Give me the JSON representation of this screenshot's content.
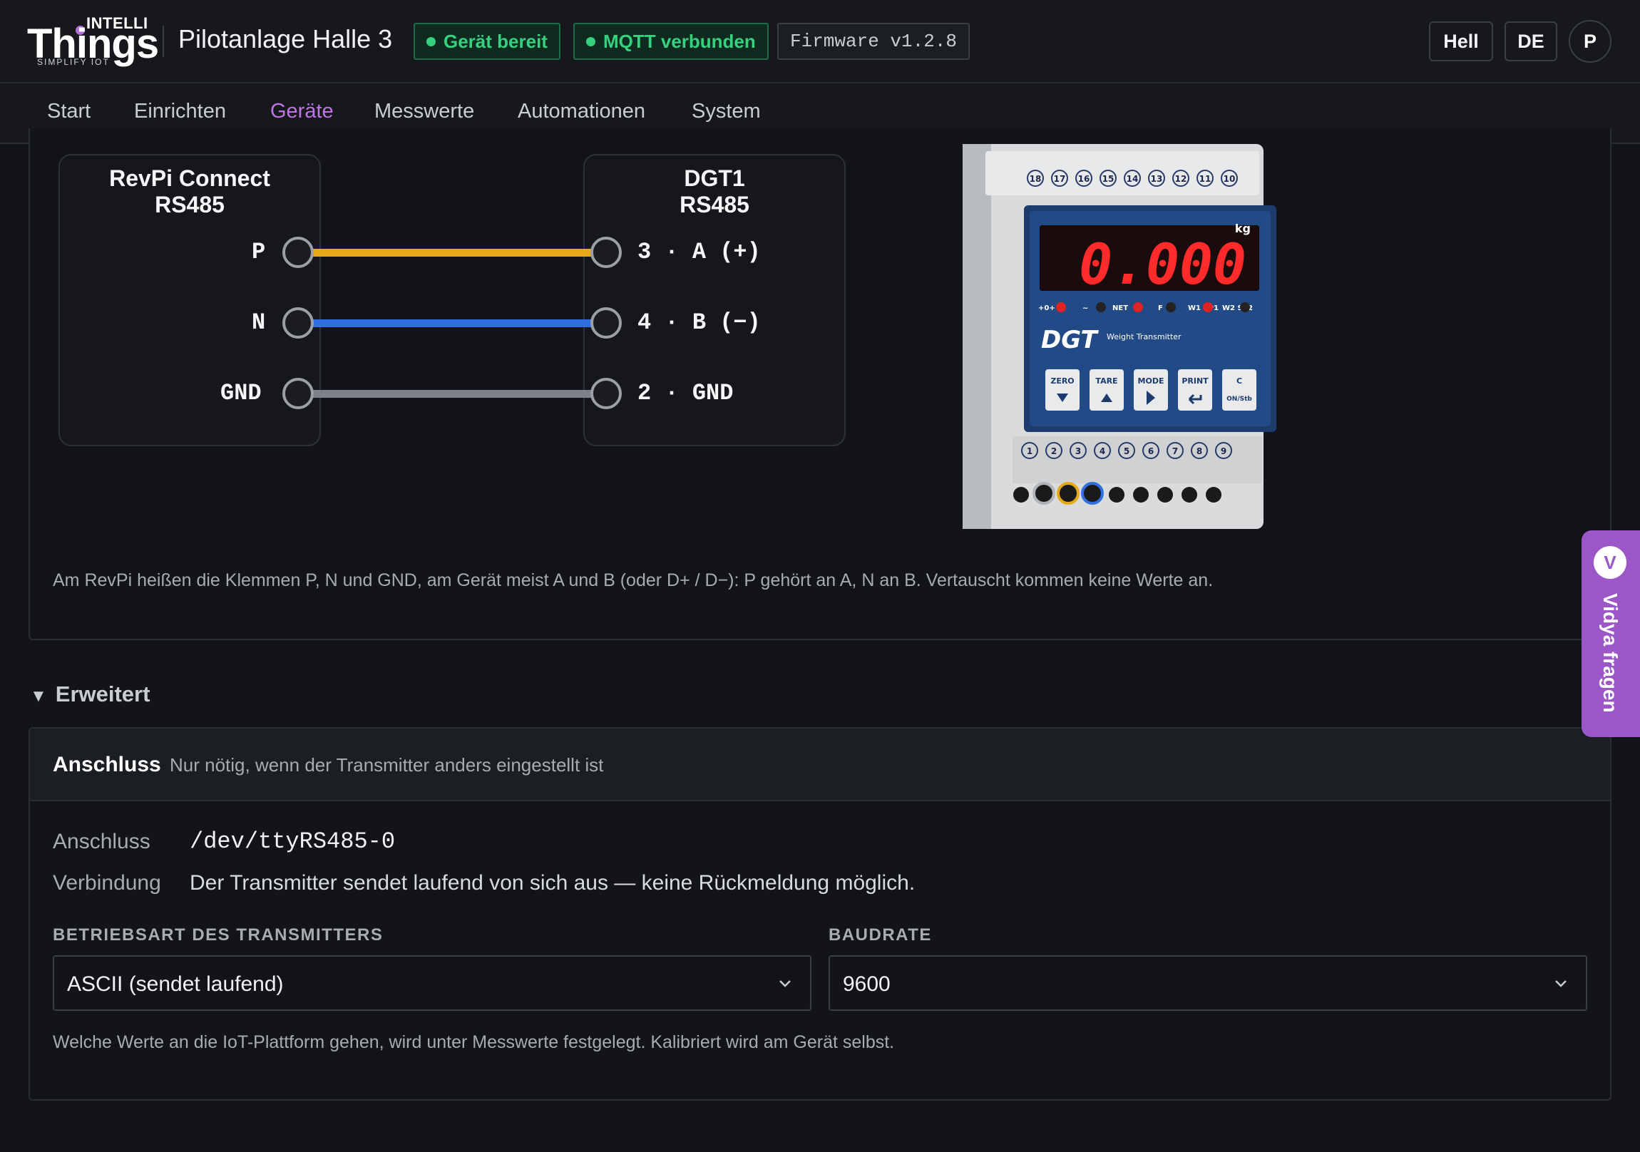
{
  "header": {
    "logo_intelli": "INTELLI",
    "logo_things": "Things",
    "logo_tagline": "SIMPLIFY IOT",
    "plant_title": "Pilotanlage Halle 3",
    "status_device": "Gerät bereit",
    "status_mqtt": "MQTT verbunden",
    "firmware": "Firmware v1.2.8",
    "theme_button": "Hell",
    "language_button": "DE",
    "avatar": "P"
  },
  "tabs": {
    "start": "Start",
    "setup": "Einrichten",
    "devices": "Geräte",
    "measurements": "Messwerte",
    "automations": "Automationen",
    "system": "System"
  },
  "wiring": {
    "left_box_title": "RevPi Connect\nRS485",
    "right_box_title": "DGT1\nRS485",
    "rows": [
      {
        "left": "P",
        "right": "3 · A (+)",
        "color": "#e6a817"
      },
      {
        "left": "N",
        "right": "4 · B (−)",
        "color": "#2f6fe0"
      },
      {
        "left": "GND",
        "right": "2 · GND",
        "color": "#7d8189"
      }
    ],
    "note": "Am RevPi heißen die Klemmen P, N und GND, am Gerät meist A und B (oder D+ / D−): P gehört an A, N an B. Vertauscht kommen keine Werte an."
  },
  "device_image": {
    "display_value": "0.000",
    "unit": "kg",
    "brand": "DGT",
    "subtitle": "Weight Transmitter",
    "keys": [
      "ZERO",
      "TARE",
      "MODE",
      "PRINT",
      "C"
    ],
    "key_sub_c": "ON/Stb",
    "top_terminals": [
      "18",
      "17",
      "16",
      "15",
      "14",
      "13",
      "12",
      "11",
      "10"
    ],
    "bottom_terminals": [
      "1",
      "2",
      "3",
      "4",
      "5",
      "6",
      "7",
      "8",
      "9"
    ],
    "indicators": [
      "+0+",
      "~",
      "NET",
      "F",
      "W1 SP1",
      "W2 SP2"
    ]
  },
  "advanced": {
    "toggle_label": "Erweitert",
    "section_title": "Anschluss",
    "section_subtitle": "Nur nötig, wenn der Transmitter anders eingestellt ist",
    "port_label": "Anschluss",
    "port_value": "/dev/ttyRS485-0",
    "connection_label": "Verbindung",
    "connection_value": "Der Transmitter sendet laufend von sich aus — keine Rückmeldung möglich.",
    "mode_label": "BETRIEBSART DES TRANSMITTERS",
    "mode_value": "ASCII (sendet laufend)",
    "baud_label": "BAUDRATE",
    "baud_value": "9600",
    "footer_note": "Welche Werte an die IoT-Plattform gehen, wird unter Messwerte festgelegt. Kalibriert wird am Gerät selbst."
  },
  "assistant": {
    "initial": "V",
    "label": "Vidya fragen"
  }
}
